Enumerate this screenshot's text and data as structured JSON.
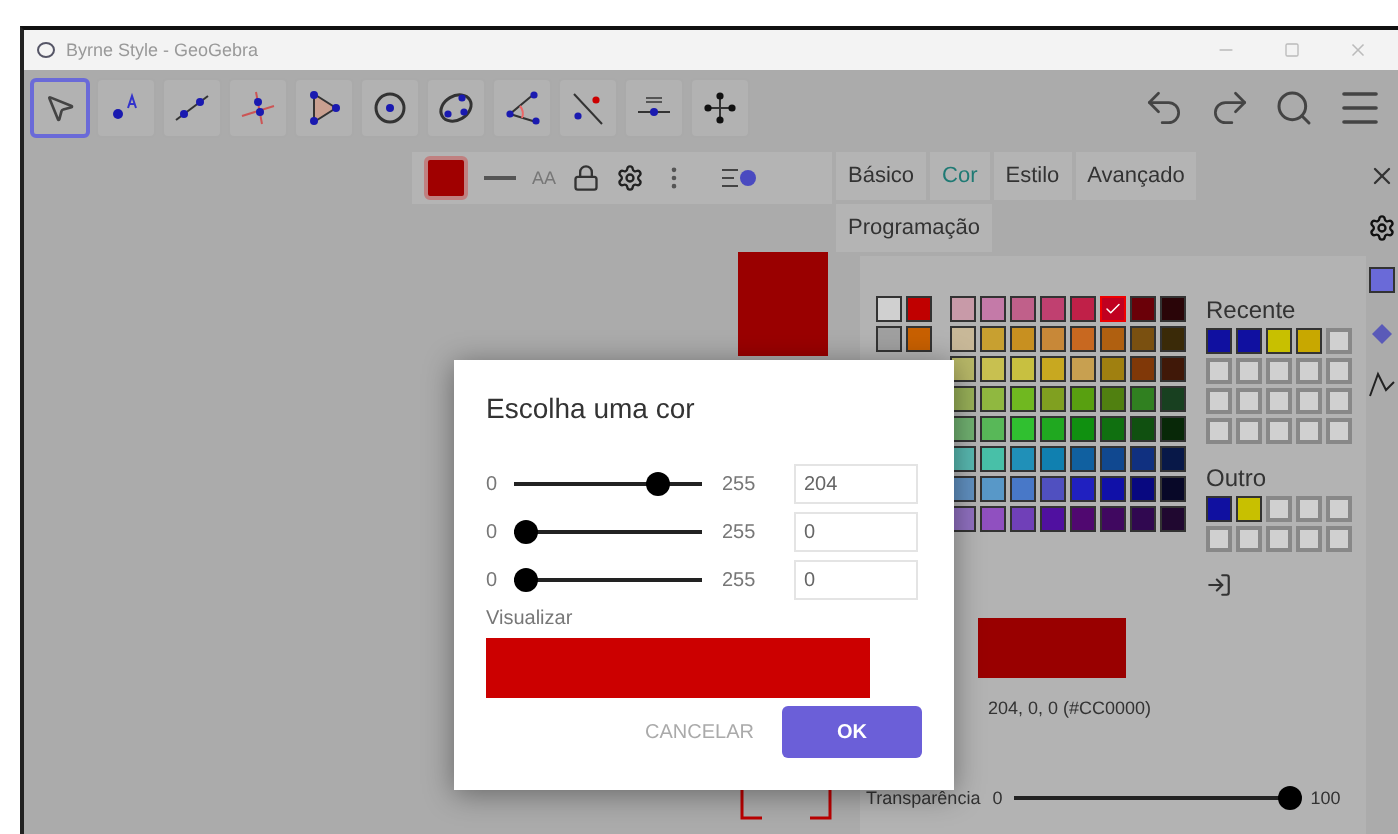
{
  "window": {
    "title": "Byrne Style - GeoGebra"
  },
  "toolbar": {
    "tools": [
      {
        "selected": true
      },
      {
        "selected": false
      },
      {
        "selected": false
      },
      {
        "selected": false
      },
      {
        "selected": false
      },
      {
        "selected": false
      },
      {
        "selected": false
      },
      {
        "selected": false
      },
      {
        "selected": false
      },
      {
        "selected": false
      },
      {
        "selected": false
      }
    ]
  },
  "style_bar": {
    "text_style": "AA"
  },
  "panel": {
    "tabs": [
      {
        "label": "Básico",
        "selected": false
      },
      {
        "label": "Cor",
        "selected": true
      },
      {
        "label": "Estilo",
        "selected": false
      },
      {
        "label": "Avançado",
        "selected": false
      },
      {
        "label": "Programação",
        "selected": false
      }
    ],
    "side_swatches": [
      [
        {
          "color": "#d0d0d0"
        },
        {
          "color": "#c00000"
        }
      ],
      [
        {
          "color": "#a0a0a0"
        },
        {
          "color": "#c86000"
        }
      ]
    ],
    "grid": [
      [
        {
          "color": "#c89aa8",
          "selected": false
        },
        {
          "color": "#c47aa8",
          "selected": false
        },
        {
          "color": "#c0608a",
          "selected": false
        },
        {
          "color": "#c04070",
          "selected": false
        },
        {
          "color": "#c02048",
          "selected": false
        },
        {
          "color": "#c00020",
          "selected": true
        },
        {
          "color": "#6a0008",
          "selected": false
        },
        {
          "color": "#2a0508",
          "selected": false
        }
      ],
      [
        {
          "color": "#c8b898",
          "selected": false
        },
        {
          "color": "#c8a030",
          "selected": false
        },
        {
          "color": "#c89020",
          "selected": false
        },
        {
          "color": "#c88838",
          "selected": false
        },
        {
          "color": "#c86820",
          "selected": false
        },
        {
          "color": "#b06010",
          "selected": false
        },
        {
          "color": "#7a5010",
          "selected": false
        },
        {
          "color": "#3a2a08",
          "selected": false
        }
      ],
      [
        {
          "color": "#b8b868",
          "selected": false
        },
        {
          "color": "#c8c050",
          "selected": false
        },
        {
          "color": "#c8c040",
          "selected": false
        },
        {
          "color": "#c8a820",
          "selected": false
        },
        {
          "color": "#c8a050",
          "selected": false
        },
        {
          "color": "#a08010",
          "selected": false
        },
        {
          "color": "#803808",
          "selected": false
        },
        {
          "color": "#401808",
          "selected": false
        }
      ],
      [
        {
          "color": "#98b058",
          "selected": false
        },
        {
          "color": "#90b840",
          "selected": false
        },
        {
          "color": "#70b820",
          "selected": false
        },
        {
          "color": "#80a020",
          "selected": false
        },
        {
          "color": "#58a010",
          "selected": false
        },
        {
          "color": "#508010",
          "selected": false
        },
        {
          "color": "#308020",
          "selected": false
        },
        {
          "color": "#184020",
          "selected": false
        }
      ],
      [
        {
          "color": "#70b070",
          "selected": false
        },
        {
          "color": "#58b858",
          "selected": false
        },
        {
          "color": "#30c030",
          "selected": false
        },
        {
          "color": "#20a820",
          "selected": false
        },
        {
          "color": "#109010",
          "selected": false
        },
        {
          "color": "#107010",
          "selected": false
        },
        {
          "color": "#105010",
          "selected": false
        },
        {
          "color": "#082808",
          "selected": false
        }
      ],
      [
        {
          "color": "#58b8b0",
          "selected": false
        },
        {
          "color": "#48c0a8",
          "selected": false
        },
        {
          "color": "#2090b8",
          "selected": false
        },
        {
          "color": "#1080b0",
          "selected": false
        },
        {
          "color": "#1060a0",
          "selected": false
        },
        {
          "color": "#104890",
          "selected": false
        },
        {
          "color": "#103080",
          "selected": false
        },
        {
          "color": "#081848",
          "selected": false
        }
      ],
      [
        {
          "color": "#6090c0",
          "selected": false
        },
        {
          "color": "#5898c8",
          "selected": false
        },
        {
          "color": "#4878c8",
          "selected": false
        },
        {
          "color": "#5050c0",
          "selected": false
        },
        {
          "color": "#2020c0",
          "selected": false
        },
        {
          "color": "#1010a8",
          "selected": false
        },
        {
          "color": "#080880",
          "selected": false
        },
        {
          "color": "#080828",
          "selected": false
        }
      ],
      [
        {
          "color": "#9070c0",
          "selected": false
        },
        {
          "color": "#9050c0",
          "selected": false
        },
        {
          "color": "#7040b8",
          "selected": false
        },
        {
          "color": "#5010a0",
          "selected": false
        },
        {
          "color": "#500870",
          "selected": false
        },
        {
          "color": "#400860",
          "selected": false
        },
        {
          "color": "#300850",
          "selected": false
        },
        {
          "color": "#200830",
          "selected": false
        }
      ]
    ],
    "recent_label": "Recente",
    "recent": [
      {
        "color": "#1010a0"
      },
      {
        "color": "#1010a0"
      },
      {
        "color": "#c8c000"
      },
      {
        "color": "#c8a800"
      },
      {
        "empty": true
      },
      {
        "empty": true
      },
      {
        "empty": true
      },
      {
        "empty": true
      },
      {
        "empty": true
      },
      {
        "empty": true
      },
      {
        "empty": true
      },
      {
        "empty": true
      },
      {
        "empty": true
      },
      {
        "empty": true
      },
      {
        "empty": true
      },
      {
        "empty": true
      },
      {
        "empty": true
      },
      {
        "empty": true
      },
      {
        "empty": true
      },
      {
        "empty": true
      }
    ],
    "other_label": "Outro",
    "other": [
      {
        "color": "#1010a0"
      },
      {
        "color": "#c8c000"
      },
      {
        "empty": true
      },
      {
        "empty": true
      },
      {
        "empty": true
      },
      {
        "empty": true
      },
      {
        "empty": true
      },
      {
        "empty": true
      },
      {
        "empty": true
      },
      {
        "empty": true
      }
    ],
    "rgb": "204, 0, 0 (#CC0000)",
    "transparency": {
      "label": "Transparência",
      "min": "0",
      "max": "100",
      "level": 0.97
    }
  },
  "dialog": {
    "title": "Escolha uma cor",
    "channels": [
      {
        "min": "0",
        "max": "255",
        "value": "204",
        "level": 0.8
      },
      {
        "min": "0",
        "max": "255",
        "value": "0",
        "level": 0
      },
      {
        "min": "0",
        "max": "255",
        "value": "0",
        "level": 0
      }
    ],
    "preview_label": "Visualizar",
    "buttons": [
      {
        "label": "CANCELAR",
        "kind": "text"
      },
      {
        "label": "OK",
        "kind": "primary"
      }
    ]
  }
}
